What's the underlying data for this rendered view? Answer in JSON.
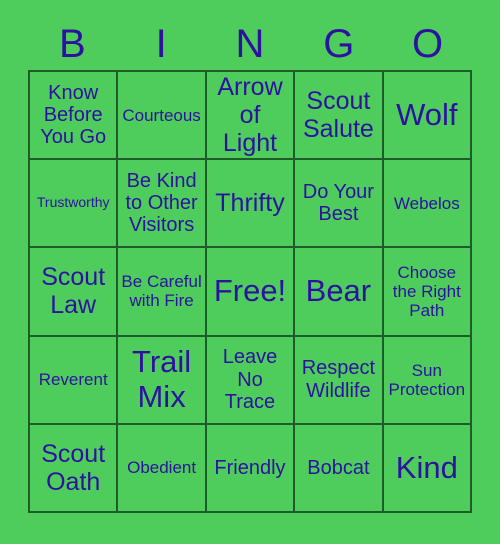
{
  "colors": {
    "background": "#4ecd5c",
    "text": "#2d12a0",
    "border": "#1f5c28"
  },
  "header": {
    "letters": [
      "B",
      "I",
      "N",
      "G",
      "O"
    ]
  },
  "grid": {
    "rows": 5,
    "columns": 5,
    "cells": [
      {
        "text": "Know Before You Go",
        "size": "sz-md"
      },
      {
        "text": "Courteous",
        "size": "sz-sm"
      },
      {
        "text": "Arrow of Light",
        "size": "sz-lg"
      },
      {
        "text": "Scout Salute",
        "size": "sz-lg"
      },
      {
        "text": "Wolf",
        "size": "sz-xl"
      },
      {
        "text": "Trustworthy",
        "size": "sz-xs"
      },
      {
        "text": "Be Kind to Other Visitors",
        "size": "sz-md"
      },
      {
        "text": "Thrifty",
        "size": "sz-lg"
      },
      {
        "text": "Do Your Best",
        "size": "sz-md"
      },
      {
        "text": "Webelos",
        "size": "sz-sm"
      },
      {
        "text": "Scout Law",
        "size": "sz-lg"
      },
      {
        "text": "Be Careful with Fire",
        "size": "sz-sm"
      },
      {
        "text": "Free!",
        "size": "sz-xl"
      },
      {
        "text": "Bear",
        "size": "sz-xl"
      },
      {
        "text": "Choose the Right Path",
        "size": "sz-sm"
      },
      {
        "text": "Reverent",
        "size": "sz-sm"
      },
      {
        "text": "Trail Mix",
        "size": "sz-xl"
      },
      {
        "text": "Leave No Trace",
        "size": "sz-md"
      },
      {
        "text": "Respect Wildlife",
        "size": "sz-md"
      },
      {
        "text": "Sun Protection",
        "size": "sz-sm"
      },
      {
        "text": "Scout Oath",
        "size": "sz-lg"
      },
      {
        "text": "Obedient",
        "size": "sz-sm"
      },
      {
        "text": "Friendly",
        "size": "sz-md"
      },
      {
        "text": "Bobcat",
        "size": "sz-md"
      },
      {
        "text": "Kind",
        "size": "sz-xl"
      }
    ]
  }
}
